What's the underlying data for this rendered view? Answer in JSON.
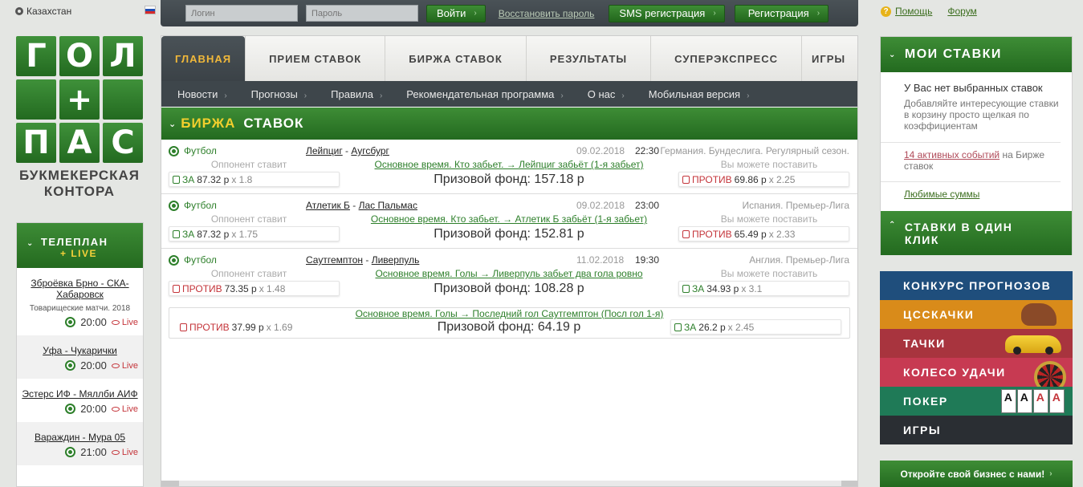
{
  "topbar": {
    "region": "Казахстан",
    "login_placeholder": "Логин",
    "password_placeholder": "Пароль",
    "login_button": "Войти",
    "restore_password": "Восстановить пароль",
    "sms_registration": "SMS регистрация",
    "registration": "Регистрация",
    "help": "Помощь",
    "forum": "Форум",
    "flag_colors": [
      "#ffffff",
      "#1f4fb4",
      "#d62a2a"
    ]
  },
  "logo": {
    "tiles": [
      "Г",
      "О",
      "Л",
      "",
      "+",
      "",
      "П",
      "А",
      "С"
    ],
    "caption_line1": "БУКМЕКЕРСКАЯ",
    "caption_line2": "КОНТОРА"
  },
  "teleplan": {
    "title": "ТЕЛЕПЛАН",
    "live": "+ LIVE",
    "items": [
      {
        "match": "Зброёвка Брно - СКА-Хабаровск",
        "sub": "Товарищеские матчи. 2018",
        "time": "20:00",
        "live": "Live"
      },
      {
        "match": "Уфа - Чукарички",
        "sub": "",
        "time": "20:00",
        "live": "Live"
      },
      {
        "match": "Эстерс ИФ - Мяллби АИФ",
        "sub": "",
        "time": "20:00",
        "live": "Live"
      },
      {
        "match": "Вараждин - Мура 05",
        "sub": "",
        "time": "21:00",
        "live": "Live"
      }
    ]
  },
  "nav": {
    "tabs": [
      "ГЛАВНАЯ",
      "ПРИЕМ СТАВОК",
      "БИРЖА СТАВОК",
      "РЕЗУЛЬТАТЫ",
      "СУПЕРЭКСПРЕСС",
      "ИГРЫ"
    ],
    "subnav": [
      "Новости",
      "Прогнозы",
      "Правила",
      "Рекомендательная программа",
      "О нас",
      "Мобильная версия"
    ]
  },
  "exchange": {
    "title_yellow": "БИРЖА",
    "title_white": "СТАВОК",
    "opponent_label": "Оппонент ставит",
    "you_can_label": "Вы можете поставить",
    "bets": [
      {
        "sport": "Футбол",
        "team1": "Лейпциг",
        "team2": "Аугсбург",
        "date": "09.02.2018",
        "time": "22:30",
        "league": "Германия. Бундеслига. Регулярный сезон.",
        "condition": "Основное время. Кто забьет. → Лейпциг забьёт (1-я забьет)",
        "prize": "Призовой фонд: 157.18 р",
        "left_type": "ЗА",
        "left_amount": "87.32 р",
        "left_coef": "x 1.8",
        "right_type": "ПРОТИВ",
        "right_amount": "69.86 р",
        "right_coef": "x 2.25"
      },
      {
        "sport": "Футбол",
        "team1": "Атлетик Б",
        "team2": "Лас Пальмас",
        "date": "09.02.2018",
        "time": "23:00",
        "league": "Испания. Премьер-Лига",
        "condition": "Основное время. Кто забьет. → Атлетик Б забьёт (1-я забьет)",
        "prize": "Призовой фонд: 152.81 р",
        "left_type": "ЗА",
        "left_amount": "87.32 р",
        "left_coef": "x 1.75",
        "right_type": "ПРОТИВ",
        "right_amount": "65.49 р",
        "right_coef": "x 2.33"
      },
      {
        "sport": "Футбол",
        "team1": "Саутгемптон",
        "team2": "Ливерпуль",
        "date": "11.02.2018",
        "time": "19:30",
        "league": "Англия. Премьер-Лига",
        "condition": "Основное время. Голы → Ливерпуль забьет два гола ровно",
        "prize": "Призовой фонд: 108.28 р",
        "left_type": "ПРОТИВ",
        "left_amount": "73.35 р",
        "left_coef": "x 1.48",
        "right_type": "ЗА",
        "right_amount": "34.93 р",
        "right_coef": "x 3.1"
      }
    ],
    "extra": {
      "condition": "Основное время. Голы → Последний гол Саутгемптон (Посл гол 1-я)",
      "prize": "Призовой фонд: 64.19 р",
      "left_type": "ПРОТИВ",
      "left_amount": "37.99 р",
      "left_coef": "x 1.69",
      "right_type": "ЗА",
      "right_amount": "26.2 р",
      "right_coef": "x 2.45"
    }
  },
  "mybets": {
    "title": "МОИ СТАВКИ",
    "empty": "У Вас нет выбранных ставок",
    "hint": "Добавляйте интересующие ставки в корзину просто щелкая по коэффициентам",
    "active_link": "14 активных событий",
    "active_rest": " на Бирже ставок",
    "favorites": "Любимые суммы",
    "oneclick_line1": "СТАВКИ В ОДИН",
    "oneclick_line2": "КЛИК"
  },
  "promo": [
    {
      "label": "КОНКУРС ПРОГНОЗОВ",
      "color": "#1f4e7c"
    },
    {
      "label": "ЦССКАЧКИ",
      "color": "#d98b1a"
    },
    {
      "label": "ТАЧКИ",
      "color": "#a8343e"
    },
    {
      "label": "КОЛЕСО УДАЧИ",
      "color": "#c73a52"
    },
    {
      "label": "ПОКЕР",
      "color": "#1f7a57"
    },
    {
      "label": "ИГРЫ",
      "color": "#2a2e33"
    }
  ],
  "poker_cards": [
    "A",
    "A",
    "A",
    "A"
  ],
  "business": "Откройте свой бизнес с нами!"
}
